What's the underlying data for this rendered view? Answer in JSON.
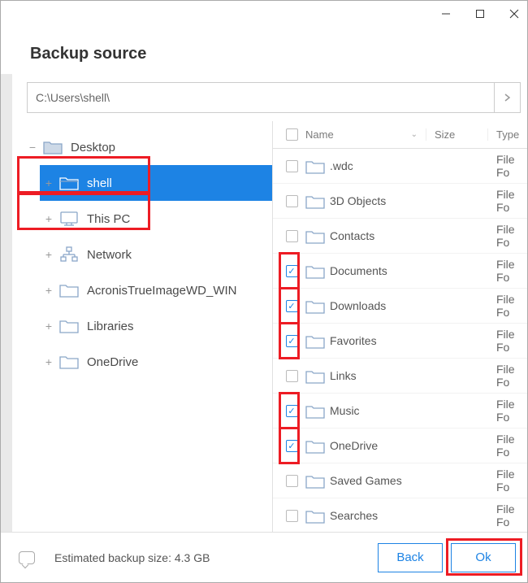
{
  "window": {
    "title": "Backup source",
    "path": "C:\\Users\\shell\\"
  },
  "tree": {
    "root": {
      "label": "Desktop",
      "expanded": true
    },
    "children": [
      {
        "label": "shell",
        "icon": "folder-outline",
        "selected": true
      },
      {
        "label": "This PC",
        "icon": "monitor"
      },
      {
        "label": "Network",
        "icon": "network"
      },
      {
        "label": "AcronisTrueImageWD_WIN",
        "icon": "folder"
      },
      {
        "label": "Libraries",
        "icon": "folder"
      },
      {
        "label": "OneDrive",
        "icon": "folder"
      }
    ]
  },
  "columns": {
    "name": "Name",
    "size": "Size",
    "type": "Type"
  },
  "files": [
    {
      "name": ".wdc",
      "type": "File Fo",
      "checked": false
    },
    {
      "name": "3D Objects",
      "type": "File Fo",
      "checked": false
    },
    {
      "name": "Contacts",
      "type": "File Fo",
      "checked": false
    },
    {
      "name": "Documents",
      "type": "File Fo",
      "checked": true,
      "highlighted": true
    },
    {
      "name": "Downloads",
      "type": "File Fo",
      "checked": true,
      "highlighted": true
    },
    {
      "name": "Favorites",
      "type": "File Fo",
      "checked": true,
      "highlighted": true
    },
    {
      "name": "Links",
      "type": "File Fo",
      "checked": false
    },
    {
      "name": "Music",
      "type": "File Fo",
      "checked": true,
      "highlighted": true
    },
    {
      "name": "OneDrive",
      "type": "File Fo",
      "checked": true,
      "highlighted": true
    },
    {
      "name": "Saved Games",
      "type": "File Fo",
      "checked": false
    },
    {
      "name": "Searches",
      "type": "File Fo",
      "checked": false
    }
  ],
  "footer": {
    "estimate_label": "Estimated backup size: 4.3 GB",
    "back": "Back",
    "ok": "Ok"
  }
}
